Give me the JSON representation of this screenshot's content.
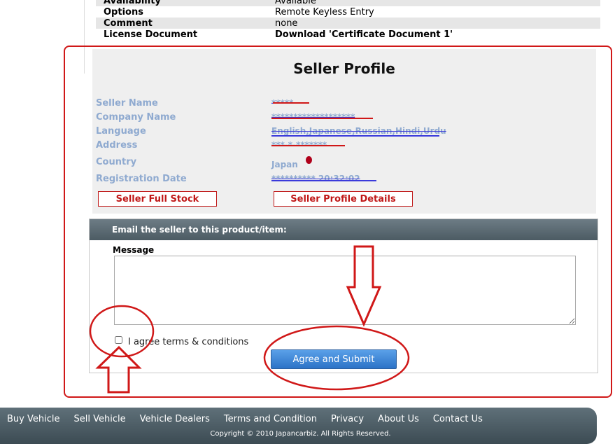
{
  "spec_rows": [
    {
      "label": "Availability",
      "value": "Available"
    },
    {
      "label": "Options",
      "value": "Remote Keyless Entry"
    },
    {
      "label": "Comment",
      "value": "none"
    },
    {
      "label": "License Document",
      "value": "Download 'Certificate Document 1'"
    }
  ],
  "seller_profile": {
    "title": "Seller Profile",
    "fields": [
      {
        "label": "Seller Name",
        "value": "*****"
      },
      {
        "label": "Company Name",
        "value": "*******************"
      },
      {
        "label": "Language",
        "value": "English,Japanese,Russian,Hindi,Urdu"
      },
      {
        "label": "Address",
        "value": "***-*-*******"
      },
      {
        "label": "Country",
        "value": "Japan"
      },
      {
        "label": "Registration Date",
        "value": "********** 20:32:02"
      }
    ],
    "full_stock_label": "Seller Full Stock",
    "profile_details_label": "Seller Profile Details"
  },
  "email": {
    "header": "Email the seller to this product/item:",
    "message_label": "Message",
    "message_value": "",
    "agree_label": "I agree terms & conditions",
    "agree_checked": false,
    "submit_label": "Agree and Submit"
  },
  "footer": {
    "nav": [
      "Buy Vehicle",
      "Sell Vehicle",
      "Vehicle Dealers",
      "Terms and Condition",
      "Privacy",
      "About Us",
      "Contact Us"
    ],
    "copyright": "Copyright © 2010 Japancarbiz. All Rights Reserved."
  },
  "colors": {
    "annotation_red": "#d01818",
    "label_blue": "#8faad0",
    "button_red": "#c01818",
    "submit_blue": "#2c73c7",
    "footer_bg": "#4c5b63"
  }
}
